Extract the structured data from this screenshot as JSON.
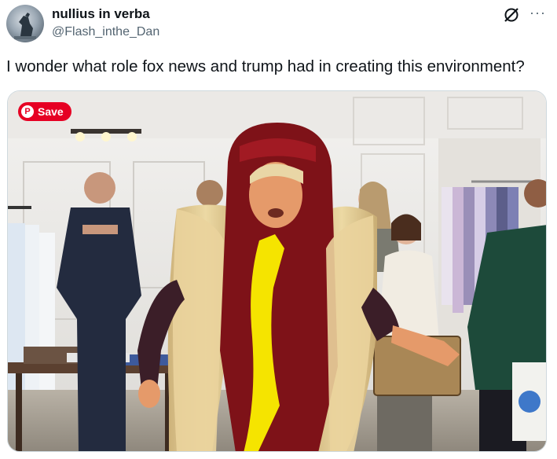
{
  "author": {
    "name": "nullius in verba",
    "handle": "@Flash_inthe_Dan"
  },
  "tweet": {
    "text": "I wonder what role fox news and trump had in creating this environment?"
  },
  "actions": {
    "more_label": "···"
  },
  "media": {
    "save_label": "Save",
    "pin_glyph": "P",
    "icons": [
      "pinterest-icon"
    ]
  },
  "icons": {
    "grok": "grok-icon",
    "more": "more-icon",
    "avatar": "avatar"
  }
}
